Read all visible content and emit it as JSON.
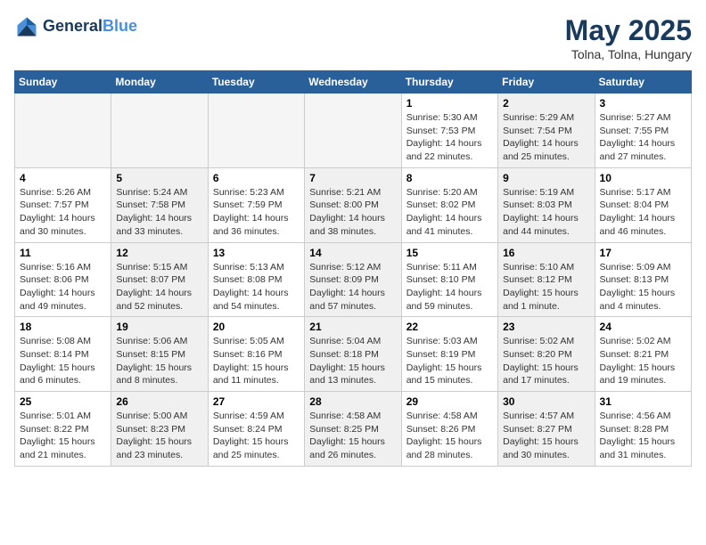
{
  "header": {
    "logo_line1": "General",
    "logo_line2": "Blue",
    "title": "May 2025",
    "subtitle": "Tolna, Tolna, Hungary"
  },
  "weekdays": [
    "Sunday",
    "Monday",
    "Tuesday",
    "Wednesday",
    "Thursday",
    "Friday",
    "Saturday"
  ],
  "weeks": [
    [
      {
        "day": "",
        "info": "",
        "shaded": false,
        "empty": true
      },
      {
        "day": "",
        "info": "",
        "shaded": false,
        "empty": true
      },
      {
        "day": "",
        "info": "",
        "shaded": false,
        "empty": true
      },
      {
        "day": "",
        "info": "",
        "shaded": false,
        "empty": true
      },
      {
        "day": "1",
        "info": "Sunrise: 5:30 AM\nSunset: 7:53 PM\nDaylight: 14 hours\nand 22 minutes.",
        "shaded": false
      },
      {
        "day": "2",
        "info": "Sunrise: 5:29 AM\nSunset: 7:54 PM\nDaylight: 14 hours\nand 25 minutes.",
        "shaded": true
      },
      {
        "day": "3",
        "info": "Sunrise: 5:27 AM\nSunset: 7:55 PM\nDaylight: 14 hours\nand 27 minutes.",
        "shaded": false
      }
    ],
    [
      {
        "day": "4",
        "info": "Sunrise: 5:26 AM\nSunset: 7:57 PM\nDaylight: 14 hours\nand 30 minutes.",
        "shaded": false
      },
      {
        "day": "5",
        "info": "Sunrise: 5:24 AM\nSunset: 7:58 PM\nDaylight: 14 hours\nand 33 minutes.",
        "shaded": true
      },
      {
        "day": "6",
        "info": "Sunrise: 5:23 AM\nSunset: 7:59 PM\nDaylight: 14 hours\nand 36 minutes.",
        "shaded": false
      },
      {
        "day": "7",
        "info": "Sunrise: 5:21 AM\nSunset: 8:00 PM\nDaylight: 14 hours\nand 38 minutes.",
        "shaded": true
      },
      {
        "day": "8",
        "info": "Sunrise: 5:20 AM\nSunset: 8:02 PM\nDaylight: 14 hours\nand 41 minutes.",
        "shaded": false
      },
      {
        "day": "9",
        "info": "Sunrise: 5:19 AM\nSunset: 8:03 PM\nDaylight: 14 hours\nand 44 minutes.",
        "shaded": true
      },
      {
        "day": "10",
        "info": "Sunrise: 5:17 AM\nSunset: 8:04 PM\nDaylight: 14 hours\nand 46 minutes.",
        "shaded": false
      }
    ],
    [
      {
        "day": "11",
        "info": "Sunrise: 5:16 AM\nSunset: 8:06 PM\nDaylight: 14 hours\nand 49 minutes.",
        "shaded": false
      },
      {
        "day": "12",
        "info": "Sunrise: 5:15 AM\nSunset: 8:07 PM\nDaylight: 14 hours\nand 52 minutes.",
        "shaded": true
      },
      {
        "day": "13",
        "info": "Sunrise: 5:13 AM\nSunset: 8:08 PM\nDaylight: 14 hours\nand 54 minutes.",
        "shaded": false
      },
      {
        "day": "14",
        "info": "Sunrise: 5:12 AM\nSunset: 8:09 PM\nDaylight: 14 hours\nand 57 minutes.",
        "shaded": true
      },
      {
        "day": "15",
        "info": "Sunrise: 5:11 AM\nSunset: 8:10 PM\nDaylight: 14 hours\nand 59 minutes.",
        "shaded": false
      },
      {
        "day": "16",
        "info": "Sunrise: 5:10 AM\nSunset: 8:12 PM\nDaylight: 15 hours\nand 1 minute.",
        "shaded": true
      },
      {
        "day": "17",
        "info": "Sunrise: 5:09 AM\nSunset: 8:13 PM\nDaylight: 15 hours\nand 4 minutes.",
        "shaded": false
      }
    ],
    [
      {
        "day": "18",
        "info": "Sunrise: 5:08 AM\nSunset: 8:14 PM\nDaylight: 15 hours\nand 6 minutes.",
        "shaded": false
      },
      {
        "day": "19",
        "info": "Sunrise: 5:06 AM\nSunset: 8:15 PM\nDaylight: 15 hours\nand 8 minutes.",
        "shaded": true
      },
      {
        "day": "20",
        "info": "Sunrise: 5:05 AM\nSunset: 8:16 PM\nDaylight: 15 hours\nand 11 minutes.",
        "shaded": false
      },
      {
        "day": "21",
        "info": "Sunrise: 5:04 AM\nSunset: 8:18 PM\nDaylight: 15 hours\nand 13 minutes.",
        "shaded": true
      },
      {
        "day": "22",
        "info": "Sunrise: 5:03 AM\nSunset: 8:19 PM\nDaylight: 15 hours\nand 15 minutes.",
        "shaded": false
      },
      {
        "day": "23",
        "info": "Sunrise: 5:02 AM\nSunset: 8:20 PM\nDaylight: 15 hours\nand 17 minutes.",
        "shaded": true
      },
      {
        "day": "24",
        "info": "Sunrise: 5:02 AM\nSunset: 8:21 PM\nDaylight: 15 hours\nand 19 minutes.",
        "shaded": false
      }
    ],
    [
      {
        "day": "25",
        "info": "Sunrise: 5:01 AM\nSunset: 8:22 PM\nDaylight: 15 hours\nand 21 minutes.",
        "shaded": false
      },
      {
        "day": "26",
        "info": "Sunrise: 5:00 AM\nSunset: 8:23 PM\nDaylight: 15 hours\nand 23 minutes.",
        "shaded": true
      },
      {
        "day": "27",
        "info": "Sunrise: 4:59 AM\nSunset: 8:24 PM\nDaylight: 15 hours\nand 25 minutes.",
        "shaded": false
      },
      {
        "day": "28",
        "info": "Sunrise: 4:58 AM\nSunset: 8:25 PM\nDaylight: 15 hours\nand 26 minutes.",
        "shaded": true
      },
      {
        "day": "29",
        "info": "Sunrise: 4:58 AM\nSunset: 8:26 PM\nDaylight: 15 hours\nand 28 minutes.",
        "shaded": false
      },
      {
        "day": "30",
        "info": "Sunrise: 4:57 AM\nSunset: 8:27 PM\nDaylight: 15 hours\nand 30 minutes.",
        "shaded": true
      },
      {
        "day": "31",
        "info": "Sunrise: 4:56 AM\nSunset: 8:28 PM\nDaylight: 15 hours\nand 31 minutes.",
        "shaded": false
      }
    ]
  ]
}
